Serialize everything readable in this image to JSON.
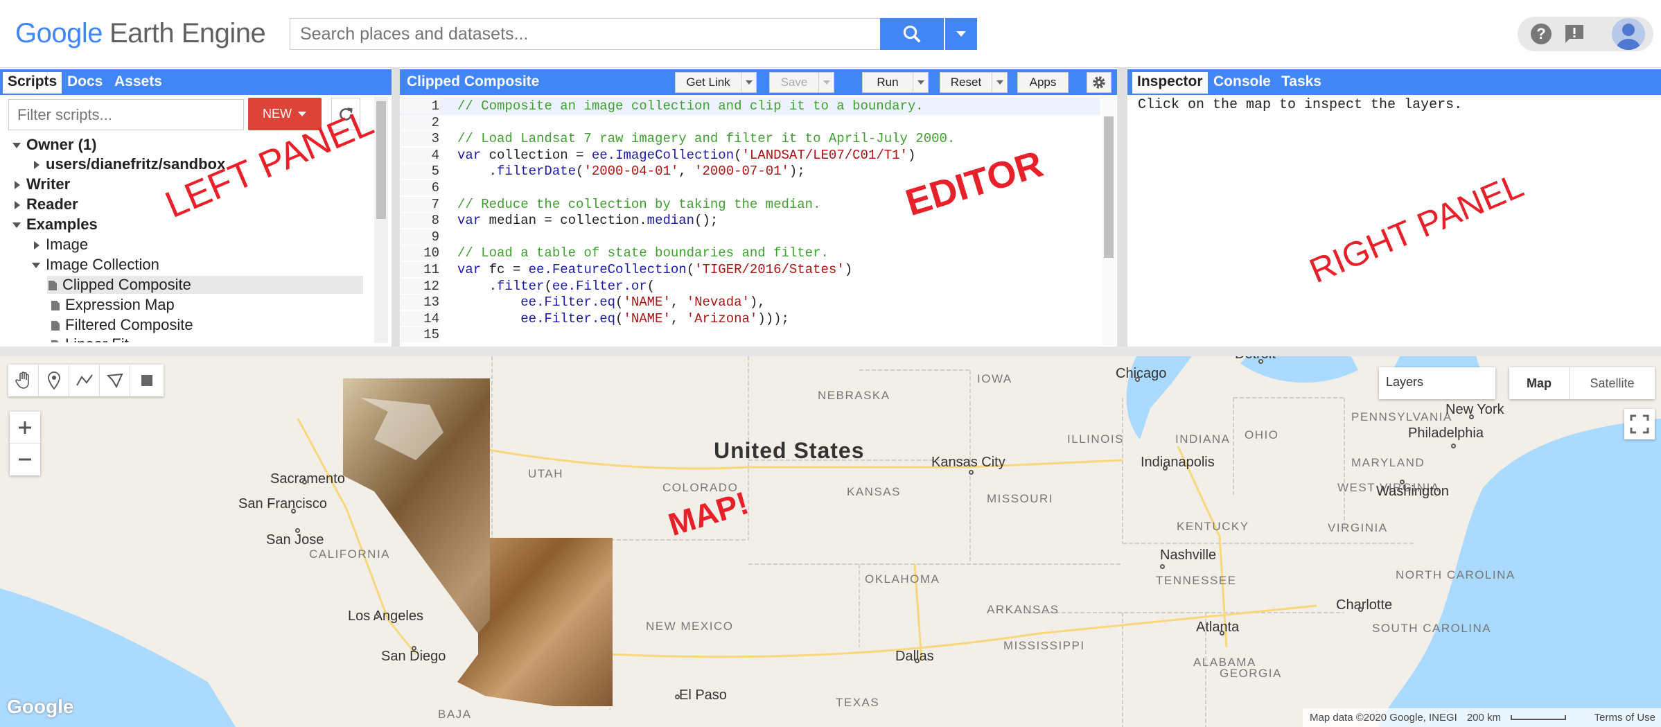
{
  "app": {
    "logo_google": "Google",
    "logo_product": "Earth Engine",
    "search_placeholder": "Search places and datasets..."
  },
  "left_panel": {
    "tabs": [
      "Scripts",
      "Docs",
      "Assets"
    ],
    "filter_placeholder": "Filter scripts...",
    "new_label": "NEW",
    "tree": [
      {
        "label": "Owner  (1)",
        "bold": true,
        "expanded": true,
        "level": 0
      },
      {
        "label": "users/dianefritz/sandbox",
        "bold": true,
        "expanded": false,
        "level": 1
      },
      {
        "label": "Writer",
        "bold": true,
        "expanded": false,
        "level": 0
      },
      {
        "label": "Reader",
        "bold": true,
        "expanded": false,
        "level": 0
      },
      {
        "label": "Examples",
        "bold": true,
        "expanded": true,
        "level": 0
      },
      {
        "label": "Image",
        "bold": false,
        "expanded": false,
        "level": 1
      },
      {
        "label": "Image Collection",
        "bold": false,
        "expanded": true,
        "level": 1
      },
      {
        "label": "Clipped Composite",
        "bold": false,
        "file": true,
        "selected": true,
        "level": 2
      },
      {
        "label": "Expression Map",
        "bold": false,
        "file": true,
        "level": 2
      },
      {
        "label": "Filtered Composite",
        "bold": false,
        "file": true,
        "level": 2
      },
      {
        "label": "Linear Fit",
        "bold": false,
        "file": true,
        "level": 2
      }
    ]
  },
  "editor": {
    "title": "Clipped Composite",
    "buttons": {
      "get_link": "Get Link",
      "save": "Save",
      "run": "Run",
      "reset": "Reset",
      "apps": "Apps"
    },
    "lines": [
      [
        [
          "com",
          "// Composite an image collection and clip it to a boundary."
        ]
      ],
      [],
      [
        [
          "com",
          "// Load Landsat 7 raw imagery and filter it to April-July 2000."
        ]
      ],
      [
        [
          "kw",
          "var"
        ],
        [
          "pl",
          " collection = "
        ],
        [
          "fn",
          "ee.ImageCollection"
        ],
        [
          "pl",
          "("
        ],
        [
          "str",
          "'LANDSAT/LE07/C01/T1'"
        ],
        [
          "pl",
          ")"
        ]
      ],
      [
        [
          "pl",
          "    ."
        ],
        [
          "fn",
          "filterDate"
        ],
        [
          "pl",
          "("
        ],
        [
          "str",
          "'2000-04-01'"
        ],
        [
          "pl",
          ", "
        ],
        [
          "str",
          "'2000-07-01'"
        ],
        [
          "pl",
          ");"
        ]
      ],
      [],
      [
        [
          "com",
          "// Reduce the collection by taking the median."
        ]
      ],
      [
        [
          "kw",
          "var"
        ],
        [
          "pl",
          " median = collection."
        ],
        [
          "fn",
          "median"
        ],
        [
          "pl",
          "();"
        ]
      ],
      [],
      [
        [
          "com",
          "// Load a table of state boundaries and filter."
        ]
      ],
      [
        [
          "kw",
          "var"
        ],
        [
          "pl",
          " fc = "
        ],
        [
          "fn",
          "ee.FeatureCollection"
        ],
        [
          "pl",
          "("
        ],
        [
          "str",
          "'TIGER/2016/States'"
        ],
        [
          "pl",
          ")"
        ]
      ],
      [
        [
          "pl",
          "    ."
        ],
        [
          "fn",
          "filter"
        ],
        [
          "pl",
          "("
        ],
        [
          "fn",
          "ee.Filter.or"
        ],
        [
          "pl",
          "("
        ]
      ],
      [
        [
          "pl",
          "        "
        ],
        [
          "fn",
          "ee.Filter.eq"
        ],
        [
          "pl",
          "("
        ],
        [
          "str",
          "'NAME'"
        ],
        [
          "pl",
          ", "
        ],
        [
          "str",
          "'Nevada'"
        ],
        [
          "pl",
          "),"
        ]
      ],
      [
        [
          "pl",
          "        "
        ],
        [
          "fn",
          "ee.Filter.eq"
        ],
        [
          "pl",
          "("
        ],
        [
          "str",
          "'NAME'"
        ],
        [
          "pl",
          ", "
        ],
        [
          "str",
          "'Arizona'"
        ],
        [
          "pl",
          ")));"
        ]
      ],
      []
    ]
  },
  "right_panel": {
    "tabs": [
      "Inspector",
      "Console",
      "Tasks"
    ],
    "inspector_text": "Click on the map to inspect the layers."
  },
  "annotations": {
    "left": "LEFT PANEL",
    "editor": "EDITOR",
    "right": "RIGHT PANEL",
    "map": "MAP!"
  },
  "map": {
    "layers_label": "Layers",
    "map_type": "Map",
    "satellite_type": "Satellite",
    "country": "United States",
    "states": [
      "NEBRASKA",
      "IOWA",
      "UTAH",
      "COLORADO",
      "KANSAS",
      "MISSOURI",
      "ILLINOIS",
      "INDIANA",
      "OHIO",
      "PENNSYLVANIA",
      "KENTUCKY",
      "WEST VIRGINIA",
      "VIRGINIA",
      "MARYLAND",
      "CALIFORNIA",
      "NEW MEXICO",
      "OKLAHOMA",
      "ARKANSAS",
      "TENNESSEE",
      "NORTH CAROLINA",
      "SOUTH CAROLINA",
      "MISSISSIPPI",
      "ALABAMA",
      "GEORGIA",
      "TEXAS",
      "BAJA"
    ],
    "cities": [
      "Chicago",
      "Detroit",
      "New York",
      "Philadelphia",
      "Indianapolis",
      "Kansas City",
      "Washington",
      "Sacramento",
      "San Francisco",
      "San Jose",
      "Los Angeles",
      "San Diego",
      "Nashville",
      "Charlotte",
      "Atlanta",
      "Dallas",
      "El Paso"
    ],
    "google_logo": "Google",
    "attribution": "Map data ©2020 Google, INEGI",
    "scale": "200 km",
    "terms": "Terms of Use"
  }
}
